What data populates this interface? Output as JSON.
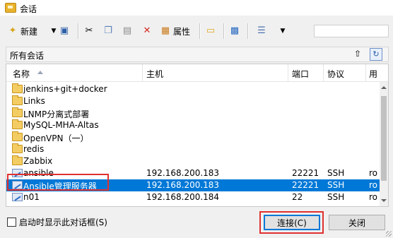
{
  "window": {
    "title": "会话"
  },
  "toolbar": {
    "new_label": "新建",
    "properties_label": "属性"
  },
  "path_bar": {
    "label": "所有会话"
  },
  "list": {
    "columns": [
      "名称",
      "主机",
      "端口",
      "协议",
      "用"
    ],
    "rows": [
      {
        "name": "jenkins+git+docker",
        "type": "folder",
        "host": "",
        "port": "",
        "protocol": "",
        "user": ""
      },
      {
        "name": "Links",
        "type": "folder",
        "host": "",
        "port": "",
        "protocol": "",
        "user": ""
      },
      {
        "name": "LNMP分离式部署",
        "type": "folder",
        "host": "",
        "port": "",
        "protocol": "",
        "user": ""
      },
      {
        "name": "MySQL-MHA-Altas",
        "type": "folder",
        "host": "",
        "port": "",
        "protocol": "",
        "user": ""
      },
      {
        "name": "OpenVPN（一）",
        "type": "folder",
        "host": "",
        "port": "",
        "protocol": "",
        "user": ""
      },
      {
        "name": "redis",
        "type": "folder",
        "host": "",
        "port": "",
        "protocol": "",
        "user": ""
      },
      {
        "name": "Zabbix",
        "type": "folder",
        "host": "",
        "port": "",
        "protocol": "",
        "user": ""
      },
      {
        "name": "ansible",
        "type": "session",
        "host": "192.168.200.183",
        "port": "22221",
        "protocol": "SSH",
        "user": "ro"
      },
      {
        "name": "Ansible管理服务器",
        "type": "session",
        "host": "192.168.200.183",
        "port": "22221",
        "protocol": "SSH",
        "user": "ro"
      },
      {
        "name": "n01",
        "type": "session",
        "host": "192.168.200.184",
        "port": "22",
        "protocol": "SSH",
        "user": "ro"
      }
    ],
    "selected_index": 8
  },
  "footer": {
    "show_on_startup_label": "启动时显示此对话框(S)",
    "connect_label": "连接(C)",
    "close_label": "关闭"
  },
  "colors": {
    "selection": "#0078d7",
    "highlight_box": "#e0312f"
  }
}
